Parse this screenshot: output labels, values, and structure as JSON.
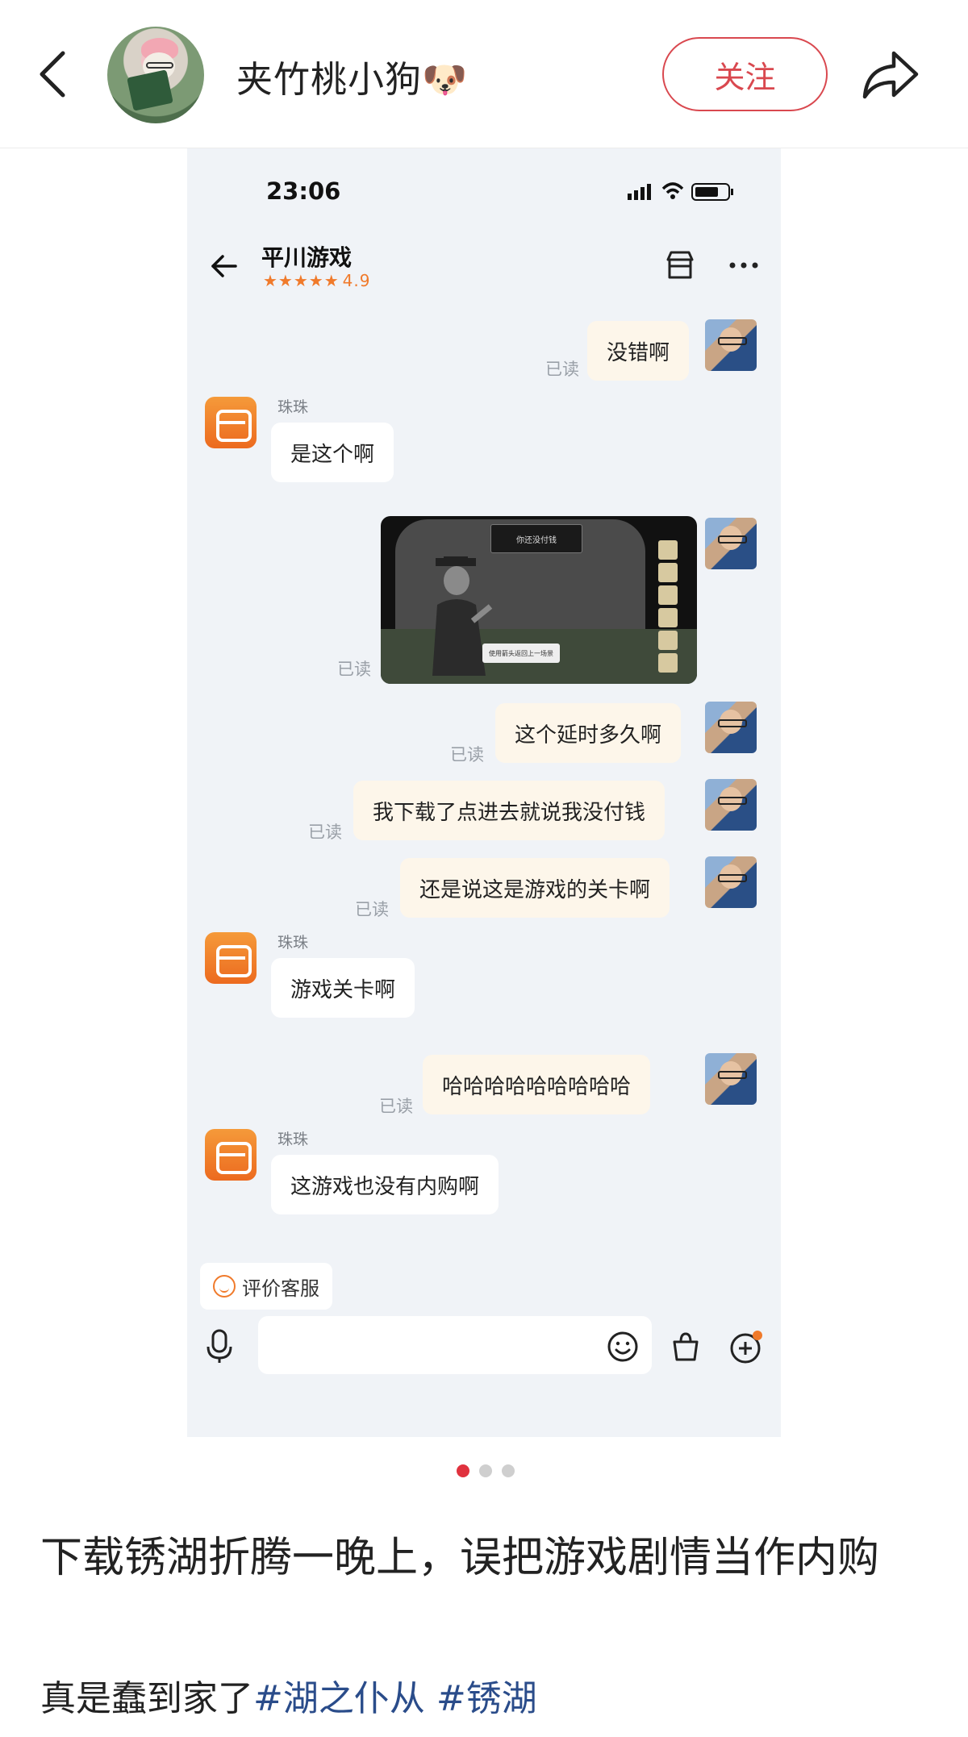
{
  "header": {
    "username": "夹竹桃小狗🐶",
    "follow_label": "关注"
  },
  "chat": {
    "status_time": "23:06",
    "shop_name": "平川游戏",
    "rating_stars": "★★★★★",
    "rating": "4.9",
    "read_label": "已读",
    "agent_name": "珠珠",
    "messages": [
      {
        "from": "me",
        "text": "没错啊"
      },
      {
        "from": "agent",
        "text": "是这个啊"
      },
      {
        "from": "me",
        "type": "image"
      },
      {
        "from": "me",
        "text": "这个延时多久啊"
      },
      {
        "from": "me",
        "text": "我下载了点进去就说我没付钱"
      },
      {
        "from": "me",
        "text": "还是说这是游戏的关卡啊"
      },
      {
        "from": "agent",
        "text": "游戏关卡啊"
      },
      {
        "from": "me",
        "text": "哈哈哈哈哈哈哈哈哈"
      },
      {
        "from": "agent",
        "text": "这游戏也没有内购啊"
      }
    ],
    "game_image": {
      "speech_text": "你还没付钱",
      "button_text": "使用箭头返回上一场景"
    },
    "rate_label": "评价客服",
    "input_placeholder": ""
  },
  "carousel": {
    "count": 3,
    "active": 1
  },
  "post": {
    "title": "下载锈湖折腾一晚上，误把游戏剧情当作内购",
    "body_text": "真是蠢到家了",
    "tags": [
      "#湖之仆从",
      "#锈湖"
    ]
  },
  "colors": {
    "accent_red": "#d9484f",
    "orange": "#f07a2b",
    "tag_blue": "#2a4c8a",
    "chat_bg": "#f0f3f7",
    "my_bubble": "#fdf6ea"
  }
}
